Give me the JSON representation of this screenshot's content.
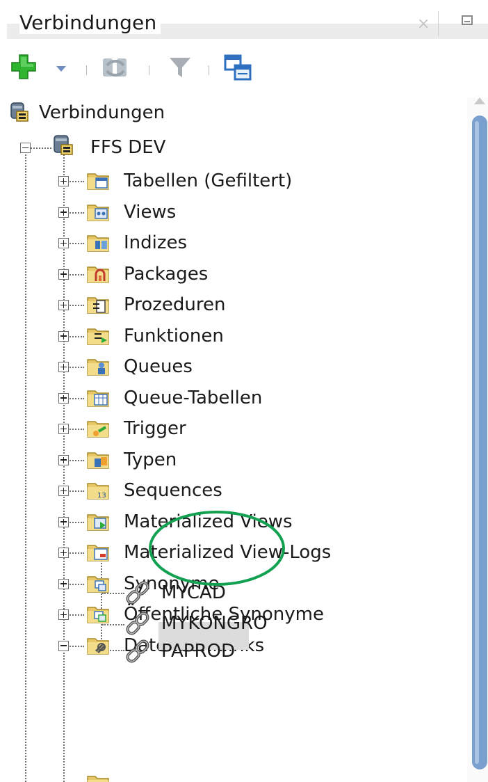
{
  "window": {
    "title": "Verbindungen",
    "close_glyph": "×"
  },
  "toolbar": {
    "icons": [
      "add-connection-icon",
      "dropdown-arrow-icon",
      "refresh-icon",
      "filter-icon",
      "schema-browser-icon"
    ]
  },
  "tree": {
    "root_label": "Verbindungen",
    "connection_label": "FFS DEV",
    "categories": [
      "Tabellen (Gefiltert)",
      "Views",
      "Indizes",
      "Packages",
      "Prozeduren",
      "Funktionen",
      "Queues",
      "Queue-Tabellen",
      "Trigger",
      "Typen",
      "Sequences",
      "Materialized Views",
      "Materialized View-Logs",
      "Synonyme",
      "Öffentliche Synonyme",
      "Datenbanklinks"
    ],
    "db_links": [
      "MYCAD",
      "MYKONGRO",
      "PAPROD"
    ],
    "selected_item": "PAPROD"
  },
  "colors": {
    "annotation_circle": "#12a150",
    "selection_bg": "#dcdcdc",
    "scrollbar_thumb": "#7aa0cf",
    "folder": "#e7c766"
  }
}
